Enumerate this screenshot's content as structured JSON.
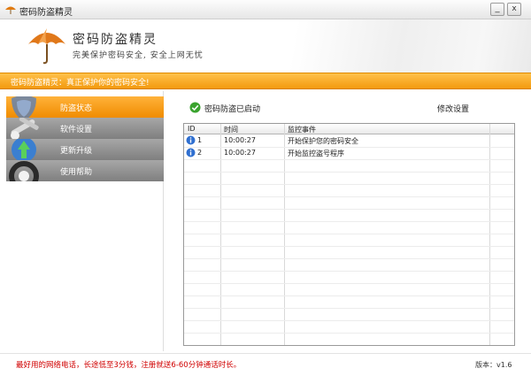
{
  "window": {
    "title": "密码防盗精灵",
    "minimize_symbol": "_",
    "close_symbol": "x"
  },
  "header": {
    "brand_title": "密码防盗精灵",
    "brand_subtitle": "完美保护密码安全, 安全上网无忧",
    "logo_icon": "umbrella-icon"
  },
  "banner": {
    "text": "密码防盗精灵：真正保护你的密码安全!"
  },
  "sidebar": {
    "items": [
      {
        "label": "防盗状态",
        "icon": "shield-icon",
        "active": true
      },
      {
        "label": "软件设置",
        "icon": "tools-icon",
        "active": false
      },
      {
        "label": "更新升级",
        "icon": "update-arrow-icon",
        "active": false
      },
      {
        "label": "使用帮助",
        "icon": "help-lifebuoy-icon",
        "active": false
      }
    ]
  },
  "status": {
    "text": "密码防盗已启动",
    "icon": "check-icon",
    "modify_label": "修改设置"
  },
  "table": {
    "columns": [
      "ID",
      "时间",
      "监控事件"
    ],
    "rows": [
      {
        "id": "1",
        "time": "10:00:27",
        "event": "开始保护您的密码安全"
      },
      {
        "id": "2",
        "time": "10:00:27",
        "event": "开始监控盗号程序"
      }
    ]
  },
  "footer": {
    "note": "最好用的网络电话，长途低至3分钱，注册就送6-60分钟通话时长。",
    "version": "版本：v1.6"
  },
  "colors": {
    "accent_orange": "#f39a0e",
    "nav_gray": "#8f8f8f",
    "footer_red": "#d00000",
    "check_green": "#3aa32e",
    "info_blue": "#2f6fd0"
  }
}
